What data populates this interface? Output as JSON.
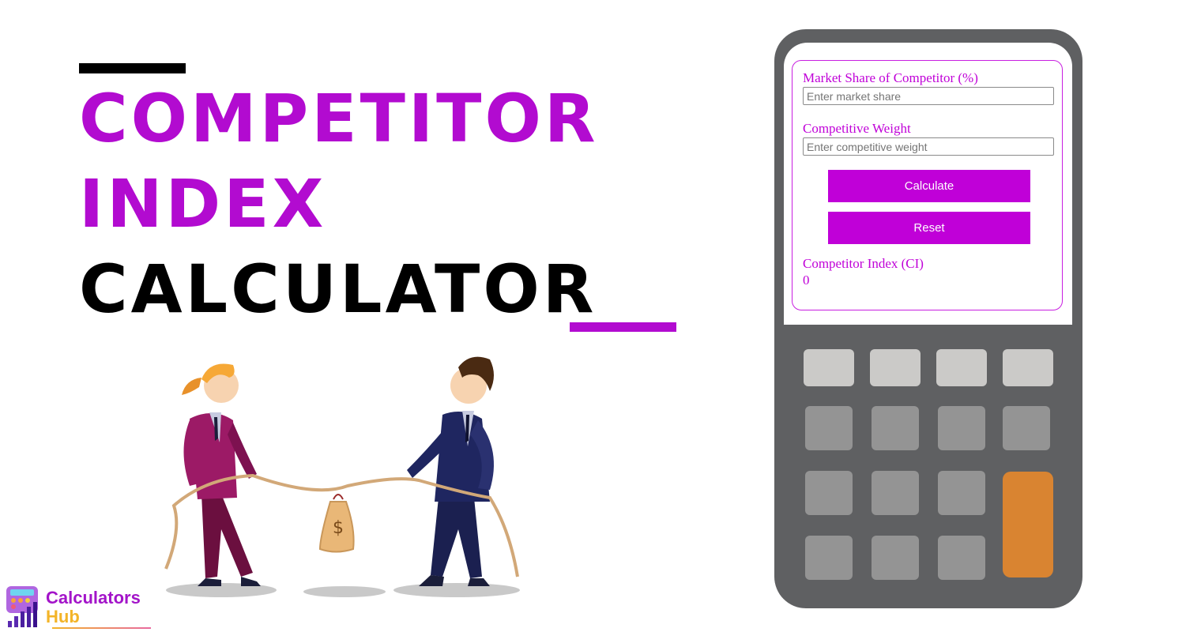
{
  "title": {
    "line1": "COMPETITOR",
    "line2": "INDEX",
    "line3": "CALCULATOR"
  },
  "colors": {
    "accent": "#b20bd0",
    "button": "#c000d8",
    "calculator_body": "#5f6062",
    "key_light": "#cbcac8",
    "key_mid": "#949494",
    "key_orange": "#d98431"
  },
  "form": {
    "market_share_label": "Market Share of Competitor (%)",
    "market_share_placeholder": "Enter market share",
    "weight_label": "Competitive Weight",
    "weight_placeholder": "Enter competitive weight",
    "calculate_label": "Calculate",
    "reset_label": "Reset",
    "result_label": "Competitor Index (CI)",
    "result_value": "0"
  },
  "brand": {
    "name_line1": "Calculators",
    "name_line2": "Hub"
  },
  "illustration": {
    "description": "Two business people in tug-of-war over a money bag",
    "bag_symbol": "$"
  }
}
